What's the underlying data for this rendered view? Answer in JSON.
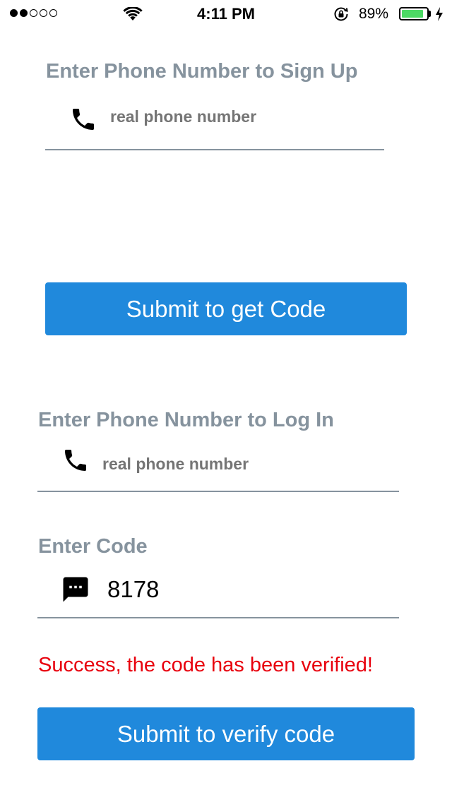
{
  "status_bar": {
    "time": "4:11 PM",
    "battery_percent": "89%",
    "battery_level": 0.89,
    "signal_bars_filled": 2,
    "signal_bars_total": 5
  },
  "signup": {
    "title": "Enter Phone Number to Sign Up",
    "phone_placeholder": "real phone number",
    "phone_value": "",
    "icon": "phone-icon",
    "submit_label": "Submit to get Code"
  },
  "login": {
    "title": "Enter Phone Number to Log In",
    "phone_placeholder": "real phone number",
    "phone_value": "",
    "icon": "phone-icon"
  },
  "code": {
    "title": "Enter Code",
    "value": "8178",
    "icon": "message-icon",
    "success_message": "Success, the code has been verified!",
    "submit_label": "Submit to verify code"
  },
  "colors": {
    "primary_button": "#2089dc",
    "label_gray": "#86939e",
    "placeholder_green": "#6ab04c",
    "error_red": "#e8000d",
    "battery_green": "#4cd964"
  }
}
